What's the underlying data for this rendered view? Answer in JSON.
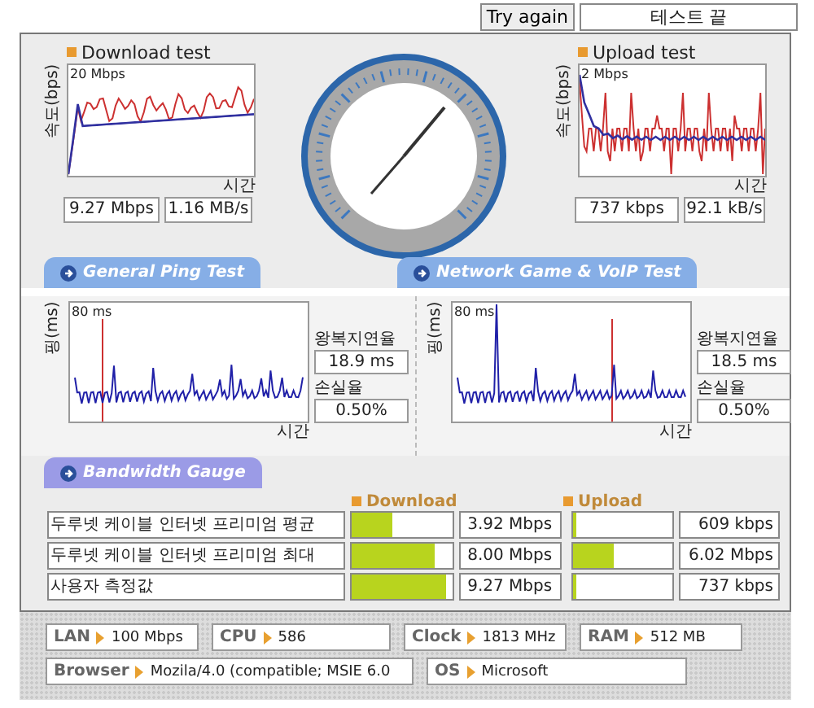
{
  "header": {
    "try_again": "Try again",
    "status": "테스트 끝"
  },
  "speed_tests": [
    {
      "title": "Download test",
      "ylabel": "속도(bps)",
      "max_label": "20 Mbps",
      "xlabel": "시간",
      "readings": [
        "9.27 Mbps",
        "1.16 MB/s"
      ]
    },
    {
      "title": "Upload test",
      "ylabel": "속도(bps)",
      "max_label": "2 Mbps",
      "xlabel": "시간",
      "readings": [
        "737 kbps",
        "92.1 kB/s"
      ]
    }
  ],
  "tabs": [
    {
      "label": "General Ping Test",
      "color": "#86aee6"
    },
    {
      "label": "Network Game & VoIP Test",
      "color": "#86aee6"
    }
  ],
  "ping_tests": [
    {
      "ylabel": "핑(ms)",
      "max_label": "80 ms",
      "xlabel": "시간",
      "latency_label": "왕복지연율",
      "latency": "18.9 ms",
      "loss_label": "손실율",
      "loss": "0.50%"
    },
    {
      "ylabel": "핑(ms)",
      "max_label": "80 ms",
      "xlabel": "시간",
      "latency_label": "왕복지연율",
      "latency": "18.5 ms",
      "loss_label": "손실율",
      "loss": "0.50%"
    }
  ],
  "bandwidth": {
    "tab": {
      "label": "Bandwidth Gauge",
      "color": "#9b9be6"
    },
    "download_label": "Download",
    "upload_label": "Upload",
    "rows": [
      {
        "name": "두루넷 케이블 인터넷 프리미엄 평균",
        "download": {
          "level": 0.4,
          "value": "3.92 Mbps"
        },
        "upload": {
          "level": 0.03,
          "value": "609 kbps"
        }
      },
      {
        "name": "두루넷 케이블 인터넷 프리미엄 최대",
        "download": {
          "level": 0.82,
          "value": "8.00 Mbps"
        },
        "upload": {
          "level": 0.42,
          "value": "6.02 Mbps"
        }
      },
      {
        "name": "사용자 측정값",
        "download": {
          "level": 0.95,
          "value": "9.27 Mbps"
        },
        "upload": {
          "level": 0.04,
          "value": "737 kbps"
        }
      }
    ]
  },
  "system": [
    {
      "label": "LAN",
      "value": "100 Mbps"
    },
    {
      "label": "CPU",
      "value": "586"
    },
    {
      "label": "Clock",
      "value": "1813 MHz"
    },
    {
      "label": "RAM",
      "value": "512 MB"
    },
    {
      "label": "Browser",
      "value": "Mozila/4.0 (compatible; MSIE 6.0"
    },
    {
      "label": "OS",
      "value": "Microsoft"
    }
  ]
}
